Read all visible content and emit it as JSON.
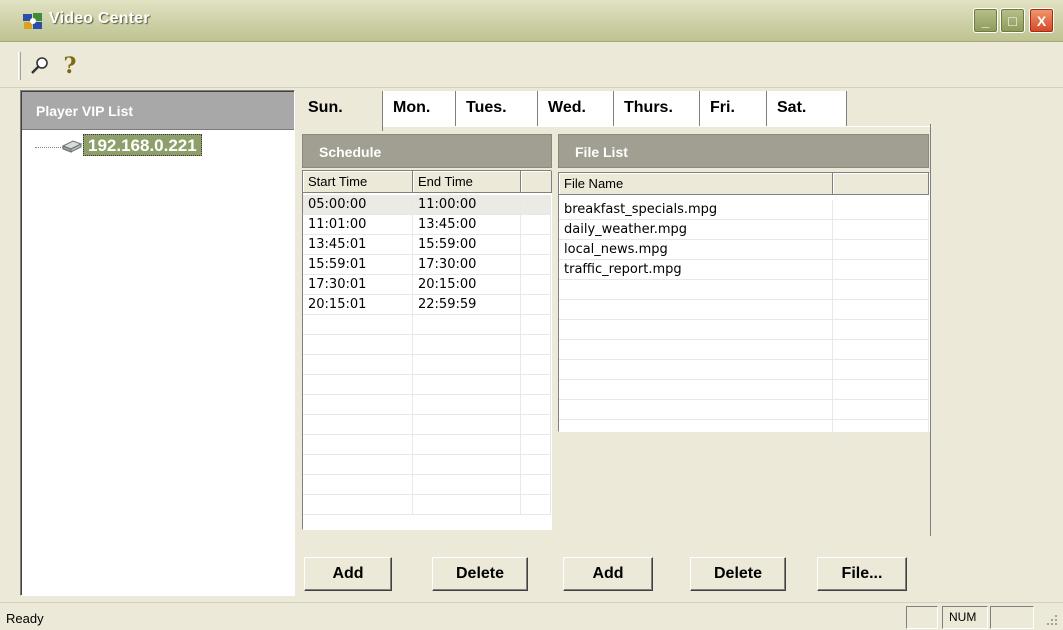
{
  "window": {
    "title": "Video Center"
  },
  "icons": {
    "app": "video-center-icon",
    "search": "magnifier-icon",
    "help": "help-icon",
    "server": "server-icon"
  },
  "toolbar": {
    "help_glyph": "?"
  },
  "window_controls": {
    "minimize": "_",
    "maximize": "□",
    "close": "X"
  },
  "left_panel": {
    "header": "Player VIP List",
    "tree": [
      {
        "label": "192.168.0.221",
        "selected": true
      }
    ]
  },
  "tabs": [
    {
      "label": "Sun.",
      "active": true
    },
    {
      "label": "Mon.",
      "active": false
    },
    {
      "label": "Tues.",
      "active": false
    },
    {
      "label": "Wed.",
      "active": false
    },
    {
      "label": "Thurs.",
      "active": false
    },
    {
      "label": "Fri.",
      "active": false
    },
    {
      "label": "Sat.",
      "active": false
    }
  ],
  "schedule": {
    "header": "Schedule",
    "columns": [
      "Start Time",
      "End Time"
    ],
    "rows": [
      [
        "05:00:00",
        "11:00:00"
      ],
      [
        "11:01:00",
        "13:45:00"
      ],
      [
        "13:45:01",
        "15:59:00"
      ],
      [
        "15:59:01",
        "17:30:00"
      ],
      [
        "17:30:01",
        "20:15:00"
      ],
      [
        "20:15:01",
        "22:59:59"
      ]
    ]
  },
  "file_list": {
    "header": "File List",
    "columns": [
      "File Name"
    ],
    "rows": [
      "breakfast_specials.mpg",
      "daily_weather.mpg",
      "local_news.mpg",
      "traffic_report.mpg"
    ]
  },
  "buttons": {
    "schedule_add": "Add",
    "schedule_delete": "Delete",
    "file_add": "Add",
    "file_delete": "Delete",
    "file_browse": "File..."
  },
  "status_bar": {
    "text": "Ready",
    "num": "NUM"
  },
  "colors": {
    "title_bar": "#cdd0a6",
    "panel_header": "#a09f92",
    "selected_node": "#8e9f6a"
  }
}
